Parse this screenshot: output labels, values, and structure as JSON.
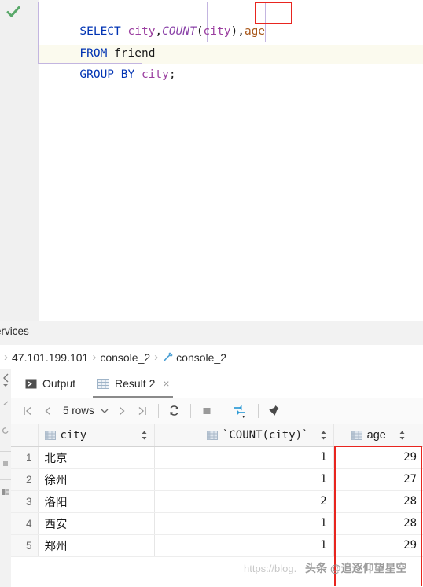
{
  "editor": {
    "status_icon": "green-check-icon",
    "lines": [
      {
        "id": "l1",
        "segments": [
          {
            "t": "SELECT ",
            "c": "kw"
          },
          {
            "t": "city",
            "c": "col"
          },
          {
            "t": ",",
            "c": "pl"
          },
          {
            "t": "COUNT",
            "c": "fn"
          },
          {
            "t": "(",
            "c": "pl"
          },
          {
            "t": "city",
            "c": "col"
          },
          {
            "t": ")",
            "c": "pl"
          },
          {
            "t": ",",
            "c": "pl"
          },
          {
            "t": "age",
            "c": "orng"
          }
        ]
      },
      {
        "id": "l2",
        "segments": [
          {
            "t": "FROM ",
            "c": "kw"
          },
          {
            "t": "friend",
            "c": "pl"
          }
        ]
      },
      {
        "id": "l3",
        "segments": [
          {
            "t": "GROUP BY ",
            "c": "kw"
          },
          {
            "t": "city",
            "c": "col"
          },
          {
            "t": ";",
            "c": "pl"
          }
        ]
      }
    ],
    "full_text": "SELECT city,COUNT(city),age\nFROM friend\nGROUP BY city;",
    "annotation_note": "red-box-around-comma-age"
  },
  "bottom_panel": {
    "services_tab_label": "ervices",
    "breadcrumb": [
      {
        "label": "47.101.199.101",
        "icon": null
      },
      {
        "label": "console_2",
        "icon": null
      },
      {
        "label": "console_2",
        "icon": "console-icon"
      }
    ],
    "tabs": [
      {
        "label": "Output",
        "icon": "console-output-icon",
        "active": false,
        "closable": false
      },
      {
        "label": "Result 2",
        "icon": "grid-icon",
        "active": true,
        "closable": true,
        "close_label": "×"
      }
    ],
    "toolbar": {
      "first_page_label": "|<",
      "prev_page_label": "<",
      "rows_label": "5 rows",
      "rows_chevron": "chevron-down-icon",
      "next_page_label": ">",
      "last_page_label": ">|",
      "refresh_icon": "refresh-icon",
      "stop_icon": "stop-icon",
      "transpose_icon": "transpose-icon",
      "pin_icon": "pin-icon"
    }
  },
  "result_grid": {
    "columns": [
      {
        "key": "idx",
        "label": "",
        "icon": null,
        "sortable": false
      },
      {
        "key": "city",
        "label": "city",
        "icon": "table-column-icon",
        "sortable": true,
        "sort_icon": "sort-updown-icon"
      },
      {
        "key": "cnt",
        "label": "`COUNT(city)`",
        "icon": "table-column-icon",
        "sortable": true,
        "sort_icon": "sort-updown-icon"
      },
      {
        "key": "age",
        "label": "age",
        "icon": "table-column-icon",
        "sortable": true,
        "sort_icon": "sort-updown-icon"
      }
    ],
    "rows": [
      {
        "idx": "1",
        "city": "北京",
        "cnt": "1",
        "age": "29"
      },
      {
        "idx": "2",
        "city": "徐州",
        "cnt": "1",
        "age": "27"
      },
      {
        "idx": "3",
        "city": "洛阳",
        "cnt": "2",
        "age": "28"
      },
      {
        "idx": "4",
        "city": "西安",
        "cnt": "1",
        "age": "28"
      },
      {
        "idx": "5",
        "city": "郑州",
        "cnt": "1",
        "age": "29"
      }
    ],
    "row_count_text": "5 rows"
  },
  "watermark": {
    "url_text": "https://blog.",
    "author_text": "头条 @追逐仰望星空"
  },
  "colors": {
    "annotation_red": "#e8251f",
    "keyword_blue": "#0033b3",
    "column_purple": "#9b3fa0",
    "function_purple": "#8a42a8",
    "literal_orange": "#a8571a",
    "accent_blue": "#2f9bd6",
    "check_green": "#59a869"
  }
}
